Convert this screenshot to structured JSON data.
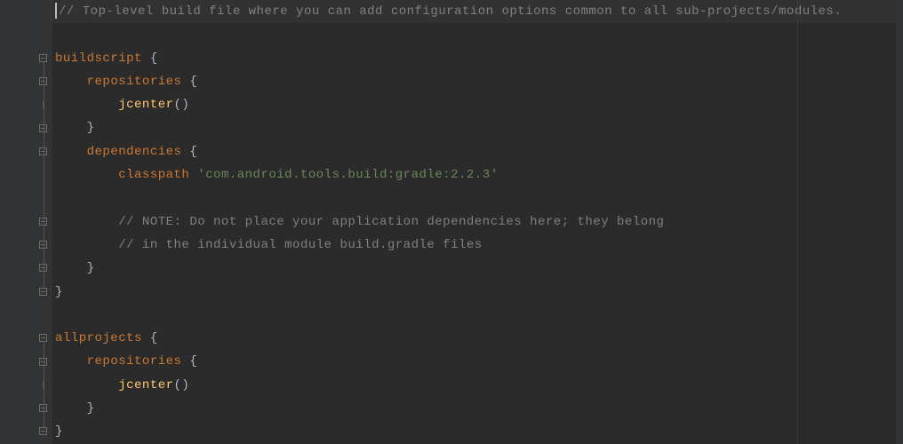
{
  "code": {
    "lines": [
      {
        "type": "comment-partial",
        "text": "// Top-level build file where you can add configuration options common to all sub-projects/modules."
      },
      {
        "type": "blank",
        "text": ""
      },
      {
        "type": "kw-brace",
        "keyword": "buildscript",
        "suffix": " {"
      },
      {
        "type": "kw-brace",
        "indent": 1,
        "keyword": "repositories",
        "suffix": " {"
      },
      {
        "type": "fn-call",
        "indent": 2,
        "fn": "jcenter",
        "suffix": "()"
      },
      {
        "type": "close",
        "indent": 1,
        "text": "}"
      },
      {
        "type": "kw-brace",
        "indent": 1,
        "keyword": "dependencies",
        "suffix": " {"
      },
      {
        "type": "classpath",
        "indent": 2,
        "keyword": "classpath",
        "string": "'com.android.tools.build:gradle:2.2.3'"
      },
      {
        "type": "blank",
        "text": ""
      },
      {
        "type": "comment",
        "indent": 2,
        "text": "// NOTE: Do not place your application dependencies here; they belong"
      },
      {
        "type": "comment",
        "indent": 2,
        "text": "// in the individual module build.gradle files"
      },
      {
        "type": "close",
        "indent": 1,
        "text": "}"
      },
      {
        "type": "close",
        "indent": 0,
        "text": "}"
      },
      {
        "type": "blank",
        "text": ""
      },
      {
        "type": "kw-brace",
        "keyword": "allprojects",
        "suffix": " {"
      },
      {
        "type": "kw-brace",
        "indent": 1,
        "keyword": "repositories",
        "suffix": " {"
      },
      {
        "type": "fn-call",
        "indent": 2,
        "fn": "jcenter",
        "suffix": "()"
      },
      {
        "type": "close",
        "indent": 1,
        "text": "}"
      },
      {
        "type": "close",
        "indent": 0,
        "text": "}"
      }
    ]
  },
  "fold_markers": [
    {
      "row": 2,
      "kind": "open"
    },
    {
      "row": 3,
      "kind": "open"
    },
    {
      "row": 4,
      "kind": "mid"
    },
    {
      "row": 5,
      "kind": "close"
    },
    {
      "row": 6,
      "kind": "open"
    },
    {
      "row": 9,
      "kind": "open"
    },
    {
      "row": 10,
      "kind": "close"
    },
    {
      "row": 11,
      "kind": "close"
    },
    {
      "row": 12,
      "kind": "close"
    },
    {
      "row": 14,
      "kind": "open"
    },
    {
      "row": 15,
      "kind": "open"
    },
    {
      "row": 16,
      "kind": "mid"
    },
    {
      "row": 17,
      "kind": "close"
    },
    {
      "row": 18,
      "kind": "close"
    }
  ]
}
